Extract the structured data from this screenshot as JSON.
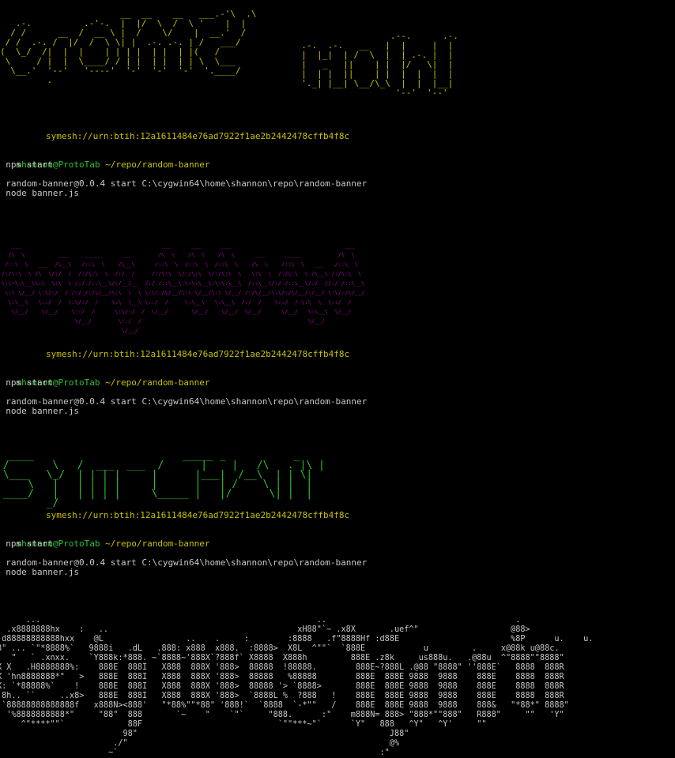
{
  "banners": [
    {
      "art": [
        "                       __  __    __   ___.-'\\  .\\",
        "   .-.          .-'-.  |  |/  \\  /  \\ '    |  |",
        "  / /      __  /  __ \\ |  /    \\/    |  __.'  /",
        " / /  .-. /  |/  /  \\ \\| |  .-. .-. | /   ___/",
        "(  \\_/  /|  |  |    | | | |  | |  | |(   /",
        " \\     / |  |  \\____/ / | |  | |  | | \\  \\___",
        "  \\__.'  '--'   '----'  '-'  '-'  '-'  '.____/",
        "         ."
      ],
      "art2": [
        "                   .--.      .-.",
        "  .-.  .-.   __   |  |     |  |",
        "  |  |_|  | /  \\  |  | .-. |  |",
        "  |   _   ||    | |  |/   \\|  |",
        "  |  | |  ||    | |  |  |  |  |",
        "  '._| |__| \\__/\\_\\  |  |  |__|",
        "                    '--'  '--'"
      ],
      "uri": "symesh://urn:btih:12a1611484e76ad7922f1ae2b2442478cffb4f8c",
      "prompt_user": "shannon@ProtoTab",
      "prompt_path": "~/repo/random-banner",
      "command": "$ npm start",
      "npm_line": "> random-banner@0.0.4 start C:\\cygwin64\\home\\shannon\\repo\\random-banner",
      "node_line": "> node banner.js"
    },
    {
      "art": [
        "   ___                                          ___      ___      ___                                  ___",
        "  /\\  \\          ___     _____      ___        /\\  \\    /\\  \\    /\\  \\      ___      _____           /\\  \\",
        " /::\\  \\   ___  /\\__\\   /::\\  \\    /\\__\\      /::\\  \\  /::\\  \\  /::\\  \\    /\\  \\    /::\\  \\   ___   /::\\  \\",
        "/:/\\:\\  \\ /\\  \\/:/  /  /:/\\:\\  \\  /:/  /     /:/\\:\\  \\/:/\\:\\  \\/:/\\:\\  \\   \\:\\  \\  /:/\\:\\  \\ /\\__\\ /:/\\:\\  \\",
        "\\:\\~\\:\\__\\\\:\\  \\:\\  \\ /:/ /::\\__\\/:/__/__  /:/ /::\\__\\:\\~\\:\\__\\:\\~\\:\\__\\  /::\\__\\/:/ /::\\__\\/:/  //:/ /::\\__\\",
        " \\:\\ \\/__/ \\:\\/:/  / /:/_/:/\\/__/\\:\\  \\  \\ \\:\\/:/\\/__/\\:\\ \\/__/\\:\\ \\/__/ /:/\\/__/\\:\\/:/\\/__/:/__/ \\:\\/:/\\/__/",
        "  \\:\\__\\   \\::/  /  \\:\\/:/  /    \\:\\  \\__\\ \\::/  /     \\:\\__\\   \\:\\__\\  /:/  /    \\::/  / \\:\\  \\  \\::/  /",
        "   \\/__/    \\/__/    \\::/  /      \\:\\/:/  /  \\/__/       \\/__/    \\/__/  \\/__/      \\/__/   \\:\\__\\  \\/__/",
        "                      \\/__/        \\::/  /                                                  \\/__/",
        "                                    \\/__/"
      ],
      "uri": "symesh://urn:btih:12a1611484e76ad7922f1ae2b2442478cffb4f8c",
      "prompt_user": "shannon@ProtoTab",
      "prompt_path": "~/repo/random-banner",
      "command": "$ npm start",
      "npm_line": "> random-banner@0.0.4 start C:\\cygwin64\\home\\shannon\\repo\\random-banner",
      "node_line": "> node banner.js"
    },
    {
      "art": [
        "  ____                        _____ _           _",
        " /       \\   /  ___  ___  /      |    |   /\\   . |\\ |",
        " \\___   \\_/  | | | |     |      |___|  /__\\  | | \\|",
        "     \\   |   | | | |     |      |   | /    \\ | |  |",
        " ____/   |   | | | |     \\_____ |   |/      \\| |  |",
        "        _/"
      ],
      "uri": "symesh://urn:btih:12a1611484e76ad7922f1ae2b2442478cffb4f8c",
      "prompt_user": "shannon@ProtoTab",
      "prompt_path": "~/repo/random-banner",
      "command": "$ npm start",
      "npm_line": "> random-banner@0.0.4 start C:\\cygwin64\\home\\shannon\\repo\\random-banner",
      "node_line": "> node banner.js"
    },
    {
      "art": [
        "      ...                                                         ..                                       .",
        "  .x8888888hx    :   ..                                       xH88\"`~ .x8X       .uef^\"                   @88>",
        " d88888888888hxx    @L                 ..    .     :        :8888   .f\"8888Hf :d88E                       %8P      u.    u.",
        "8\" ... `\"*8888%`   9888i   .dL   .888: x888  x888.  :8888>  X8L  ^\"\"`  `888E            u         .     x@88k u@88c.",
        "!  \"   ` .xnxx.    `Y888k:*888. ~`8888~'888X`?888f` X8888  X888h         888E .z8k     us888u.   .@88u  ^\"8888\"\"8888\"",
        "X X   .H8888888%:    888E  888I   X888  888X '888>  88888  !88888.        888E~?888L .@88 \"8888\" ''888E`   8888  888R",
        "X 'hn8888888*\"   >   888E  888I   X888  888X '888>  88888   %88888        888E  888E 9888  9888    888E    8888  888R",
        "X: `*88888%`    !    888E  888I   X888  888X '888>  88888 '> `8888>       888E  888E 9888  9888    888E    8888  888R",
        "'8h.. ``     ..x8>   888E  888I   X888  888X '888>  `8888L %  ?888   !    888E  888E 9888  9888    888E    8888  888R",
        " `88888888888888f   x888N><888'   \"*88%\"\"*88\" '888!`  `8888  `-*\"\"   /    888E  888E 9888  9888    888&   \"*88*\" 8888\"",
        "  '%8888888888*\"     \"88\"  888       `~    \"    `\"`     \"888.      :\"    m888N= 888> \"888*\"\"888\"   R888\"     \"\"   'Y\"",
        "     ^\"****\"\"`             88F                            `\"\"***~\"`      `Y\"   888   ^Y\"   ^Y'     \"\"",
        "                          98\"                                                    J88\"",
        "                        ./\"                                                      @%",
        "                       ~`                                                      :\""
      ]
    }
  ]
}
